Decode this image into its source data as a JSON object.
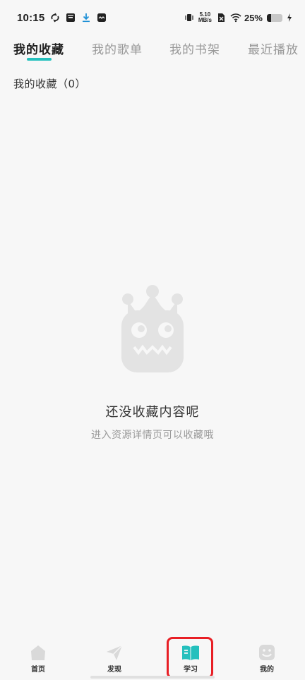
{
  "status_bar": {
    "time": "10:15",
    "net_speed_value": "5.10",
    "net_speed_unit": "MB/s",
    "battery_text": "25%",
    "battery_level": 0.25,
    "icons": [
      "sync-icon",
      "archive-icon",
      "download-icon",
      "app-icon",
      "vibrate-icon",
      "no-sim-icon",
      "wifi-icon",
      "battery-icon",
      "charging-icon"
    ]
  },
  "tabs": [
    {
      "label": "我的收藏",
      "active": true
    },
    {
      "label": "我的歌单",
      "active": false
    },
    {
      "label": "我的书架",
      "active": false
    },
    {
      "label": "最近播放",
      "active": false
    }
  ],
  "section_title": "我的收藏（0）",
  "empty_state": {
    "icon": "mascot-icon",
    "title": "还没收藏内容呢",
    "subtitle": "进入资源详情页可以收藏哦"
  },
  "bottom_nav": [
    {
      "label": "首页",
      "icon": "home-icon",
      "active": false
    },
    {
      "label": "发现",
      "icon": "discover-icon",
      "active": false
    },
    {
      "label": "学习",
      "icon": "book-icon",
      "active": true
    },
    {
      "label": "我的",
      "icon": "profile-icon",
      "active": false
    }
  ],
  "colors": {
    "accent": "#25c0bd",
    "highlight_border": "#e81f25",
    "background": "#f7f7f7"
  }
}
